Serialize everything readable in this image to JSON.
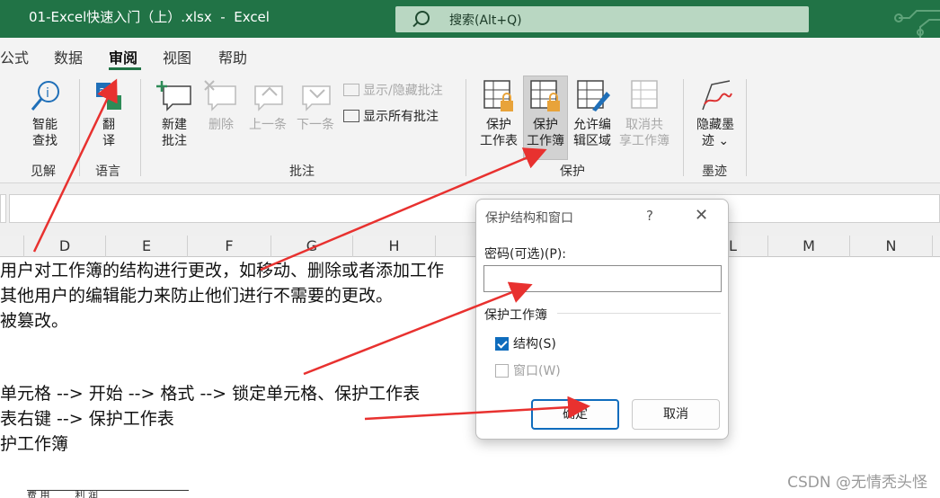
{
  "titlebar": {
    "doc_title": "01-Excel快速入门（上）.xlsx  -  Excel",
    "search_placeholder": "搜索(Alt+Q)"
  },
  "menu": {
    "tabs": [
      "公式",
      "数据",
      "审阅",
      "视图",
      "帮助"
    ],
    "active": "审阅"
  },
  "ribbon": {
    "smart_lookup": "智能\n查找",
    "translate": "翻\n译",
    "new_comment": "新建\n批注",
    "delete": "删除",
    "previous": "上一条",
    "next": "下一条",
    "show_hide_comment": "显示/隐藏批注",
    "show_all_comments": "显示所有批注",
    "protect_sheet": "保护\n工作表",
    "protect_workbook": "保护\n工作簿",
    "allow_edit_ranges": "允许编\n辑区域",
    "unshare_workbook": "取消共\n享工作簿",
    "hide_ink": "隐藏墨\n迹 ⌄",
    "groups": {
      "insights": "见解",
      "language": "语言",
      "comments": "批注",
      "protect": "保护",
      "ink": "墨迹"
    }
  },
  "columns": [
    "D",
    "E",
    "F",
    "G",
    "H",
    "L",
    "M",
    "N"
  ],
  "sheet": {
    "lines": [
      "用户对工作簿的结构进行更改，如移动、删除或者添加工作",
      "其他用户的编辑能力来防止他们进行不需要的更改。",
      "被篡改。",
      "单元格 --> 开始 --> 格式 --> 锁定单元格、保护工作表",
      "表右键 --> 保护工作表",
      "护工作簿"
    ],
    "table_fragment": "费 用        利 润"
  },
  "dialog": {
    "title": "保护结构和窗口",
    "help": "?",
    "close": "✕",
    "password_label": "密码(可选)(P):",
    "password_value": "",
    "section": "保护工作簿",
    "structure_label": "结构(S)",
    "structure_checked": true,
    "window_label": "窗口(W)",
    "window_checked": false,
    "ok": "确定",
    "cancel": "取消"
  },
  "watermark": "CSDN @无情秃头怪",
  "colors": {
    "titlebar": "#217346",
    "search": "#b9d7c2",
    "ribbon_bg": "#f3f3f3",
    "accent": "#0f6cbd",
    "annotation_arrow": "#e8312f"
  }
}
